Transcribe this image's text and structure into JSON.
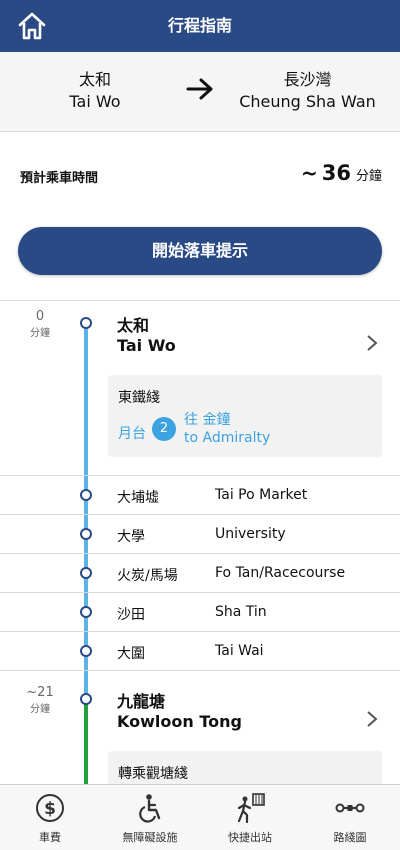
{
  "header": {
    "title": "行程指南",
    "home_icon": "home-icon"
  },
  "route": {
    "from": {
      "zh": "太和",
      "en": "Tai Wo"
    },
    "to": {
      "zh": "長沙灣",
      "en": "Cheung Sha Wan"
    },
    "arrow_icon": "arrow-right-icon"
  },
  "travel_time": {
    "label": "預計乘車時間",
    "tilde": "~",
    "value": "36",
    "unit": "分鐘"
  },
  "start_button": {
    "label": "開始落車提示"
  },
  "timeline": {
    "start": {
      "minutes": "0",
      "unit": "分鐘",
      "name_zh": "太和",
      "name_en": "Tai Wo",
      "card": {
        "line": "東鐵綫",
        "platform_label": "月台",
        "platform_num": "2",
        "dest_zh": "往 金鐘",
        "dest_en": "to Admiralty"
      }
    },
    "stops": [
      {
        "zh": "大埔墟",
        "en": "Tai Po Market"
      },
      {
        "zh": "大學",
        "en": "University"
      },
      {
        "zh": "火炭/馬場",
        "en": "Fo Tan/Racecourse"
      },
      {
        "zh": "沙田",
        "en": "Sha Tin"
      },
      {
        "zh": "大圍",
        "en": "Tai Wai"
      }
    ],
    "interchange": {
      "minutes": "~21",
      "unit": "分鐘",
      "name_zh": "九龍塘",
      "name_en": "Kowloon Tong",
      "card": {
        "line": "轉乘觀塘綫"
      }
    },
    "colors": {
      "east_rail": "#5cb3e6",
      "kwun_tong": "#22a03a",
      "platform": "#3aa3e0"
    }
  },
  "tabs": [
    {
      "label": "車費",
      "icon": "fare-dollar-icon"
    },
    {
      "label": "無障礙設施",
      "icon": "wheelchair-icon"
    },
    {
      "label": "快捷出站",
      "icon": "quick-exit-icon"
    },
    {
      "label": "路綫圖",
      "icon": "route-map-icon"
    }
  ],
  "colors": {
    "brand": "#2a4a86"
  }
}
